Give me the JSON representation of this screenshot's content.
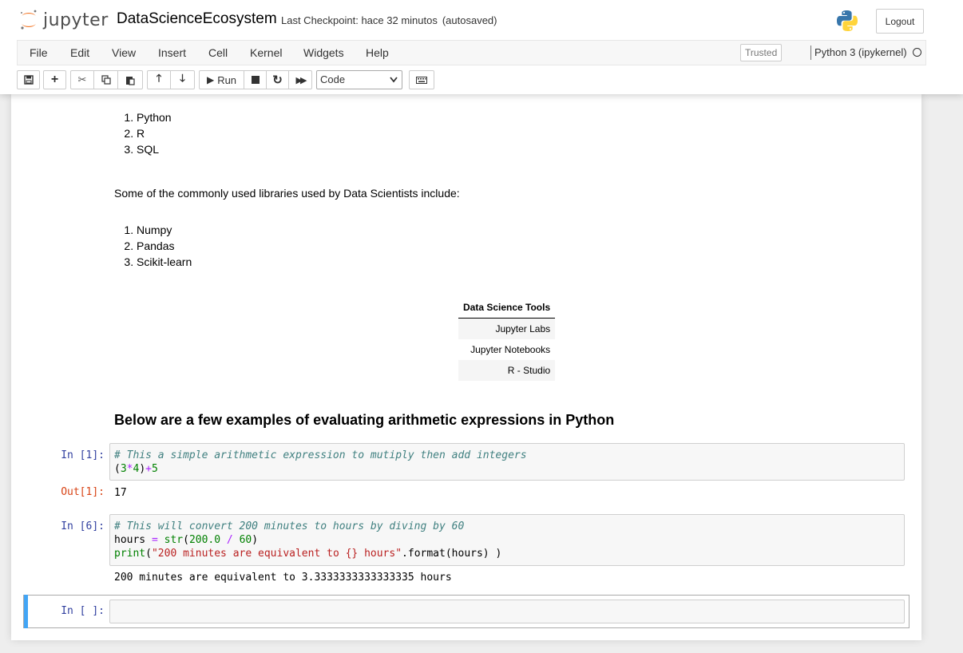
{
  "header": {
    "logo_text": "jupyter",
    "notebook_title": "DataScienceEcosystem",
    "checkpoint": "Last Checkpoint: hace 32 minutos",
    "autosaved": "(autosaved)",
    "logout_label": "Logout"
  },
  "menubar": {
    "items": [
      "File",
      "Edit",
      "View",
      "Insert",
      "Cell",
      "Kernel",
      "Widgets",
      "Help"
    ],
    "trusted": "Trusted",
    "kernel": "Python 3 (ipykernel)"
  },
  "toolbar": {
    "run_label": "Run",
    "cell_type": "Code",
    "icons": [
      "save-icon",
      "plus-icon",
      "cut-icon",
      "copy-icon",
      "paste-icon",
      "arrow-up-icon",
      "arrow-down-icon",
      "run-icon",
      "stop-icon",
      "restart-icon",
      "fast-forward-icon",
      "keyboard-icon"
    ]
  },
  "content": {
    "languages": [
      "Python",
      "R",
      "SQL"
    ],
    "libraries_intro": "Some of the commonly used libraries used by Data Scientists include:",
    "libraries": [
      "Numpy",
      "Pandas",
      "Scikit-learn"
    ],
    "tools_table": {
      "header": "Data Science Tools",
      "rows": [
        "Jupyter Labs",
        "Jupyter Notebooks",
        "R - Studio"
      ]
    },
    "arith_heading": "Below are a few examples of evaluating arithmetic expressions in Python"
  },
  "cells": [
    {
      "prompt": "In [1]:",
      "comment": "# This a simple arithmetic expression to mutiply then add integers",
      "out_prompt": "Out[1]:",
      "output": "17"
    },
    {
      "prompt": "In [6]:",
      "comment": "# This will convert 200 minutes to hours by diving by 60",
      "output": "200 minutes are equivalent to 3.3333333333333335 hours"
    },
    {
      "prompt": "In [ ]:"
    }
  ],
  "colors": {
    "in_prompt": "#303f9f",
    "out_prompt": "#d84315",
    "selected_bar": "#42a5f5"
  }
}
